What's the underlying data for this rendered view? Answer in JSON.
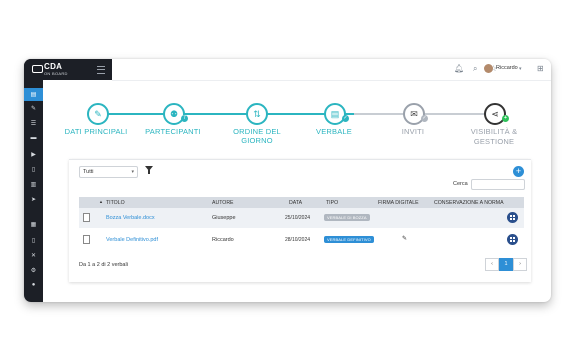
{
  "app": {
    "logo_title": "CDA",
    "logo_subtitle": "ON BOARD"
  },
  "topbar": {
    "icons": [
      "bell-icon",
      "search-icon",
      "star-icon",
      "grid-icon"
    ],
    "user_name": "Riccardo",
    "user_caret": "▾"
  },
  "sidebar": {
    "items": [
      "dashboard-icon",
      "edit-icon",
      "list-icon",
      "folder-icon",
      "video-icon",
      "document-icon",
      "chart-icon",
      "send-icon",
      "calendar-icon",
      "file-icon",
      "tools-icon",
      "users-icon",
      "info-icon"
    ]
  },
  "stepper": {
    "steps": [
      {
        "label": "DATI PRINCIPALI",
        "state": "done",
        "icon": "edit-icon"
      },
      {
        "label": "PARTECIPANTI",
        "state": "done",
        "icon": "users-icon",
        "badge": "7"
      },
      {
        "label": "ORDINE DEL GIORNO",
        "state": "done",
        "icon": "list-icon"
      },
      {
        "label": "VERBALE",
        "state": "done",
        "icon": "document-icon",
        "badge": "✓"
      },
      {
        "label": "INVITI",
        "state": "inactive",
        "icon": "envelope-icon",
        "badge": "✓"
      },
      {
        "label": "VISIBILITÀ  &\nGESTIONE",
        "state": "current",
        "icon": "share-icon",
        "badge": "+"
      }
    ],
    "colors": {
      "done": "#2bb5c0",
      "inactive": "#9aa1ab",
      "current": "#333333",
      "badge_green": "#2ec25b"
    }
  },
  "table_controls": {
    "filter_select": "Tutti",
    "search_label": "Cerca",
    "search_value": ""
  },
  "table": {
    "headers": [
      "TITOLO",
      "AUTORE",
      "DATA",
      "TIPO",
      "FIRMA DIGITALE",
      "CONSERVAZIONE A NORMA"
    ],
    "sort_indicator": "▲",
    "rows": [
      {
        "title": "Bozza Verbale.docx",
        "author": "Giuseppe",
        "date": "25/10/2024",
        "type": "VERBALE DI BOZZA",
        "type_color": "#b0b7c0",
        "signed": false
      },
      {
        "title": "Verbale Definitivo.pdf",
        "author": "Riccardo",
        "date": "28/10/2024",
        "type": "VERBALE DEFINITIVO",
        "type_color": "#2e8fd6",
        "signed": true
      }
    ]
  },
  "footer": {
    "info": "Da 1 a 2 di 2 verbali",
    "pages": [
      "‹",
      "1",
      "›"
    ],
    "active_page": "1"
  }
}
